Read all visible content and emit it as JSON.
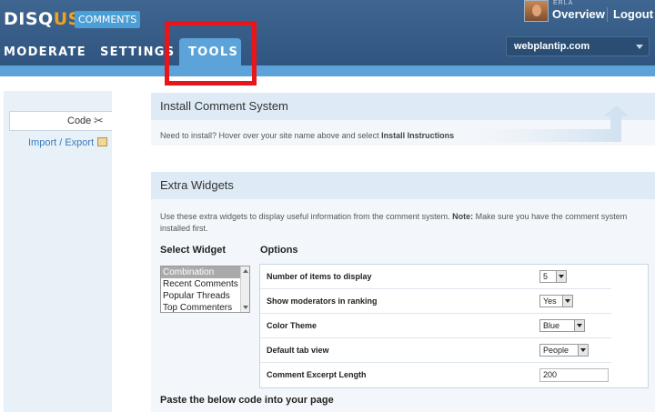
{
  "header": {
    "logo_main": "DISQ",
    "logo_accent": "US",
    "logo_badge": "COMMENTS",
    "username": "ERLA",
    "overview_label": "Overview",
    "logout_label": "Logout",
    "site_name": "webplantip.com"
  },
  "nav": {
    "tabs": [
      {
        "label": "MODERATE"
      },
      {
        "label": "SETTINGS"
      },
      {
        "label": "TOOLS",
        "active": true
      }
    ]
  },
  "sidebar": {
    "items": [
      {
        "label": "Code",
        "icon": "tools-icon"
      },
      {
        "label": "Import / Export",
        "icon": "import-export-icon"
      }
    ]
  },
  "install_panel": {
    "title": "Install Comment System",
    "desc_prefix": "Need to install? Hover over your site name above and select ",
    "desc_bold": "Install Instructions"
  },
  "widgets_panel": {
    "title": "Extra Widgets",
    "desc_prefix": "Use these extra widgets to display useful information from the comment system. ",
    "desc_bold": "Note:",
    "desc_suffix": " Make sure you have the comment system installed first.",
    "select_label": "Select Widget",
    "options_label": "Options",
    "widget_list": [
      "Combination",
      "Recent Comments",
      "Popular Threads",
      "Top Commenters"
    ],
    "selected_widget": "Combination",
    "options": [
      {
        "name": "Number of items to display",
        "value": "5"
      },
      {
        "name": "Show moderators in ranking",
        "value": "Yes"
      },
      {
        "name": "Color Theme",
        "value": "Blue"
      },
      {
        "name": "Default tab view",
        "value": "People"
      },
      {
        "name": "Comment Excerpt Length",
        "value": "200"
      }
    ],
    "paste_label": "Paste the below code into your page"
  },
  "colors": {
    "header_bg": "#3f6690",
    "accent_blue": "#5ba3d8",
    "logo_orange": "#f2a21d",
    "highlight_red": "#e8161b",
    "panel_bg": "#f3f7fb"
  }
}
